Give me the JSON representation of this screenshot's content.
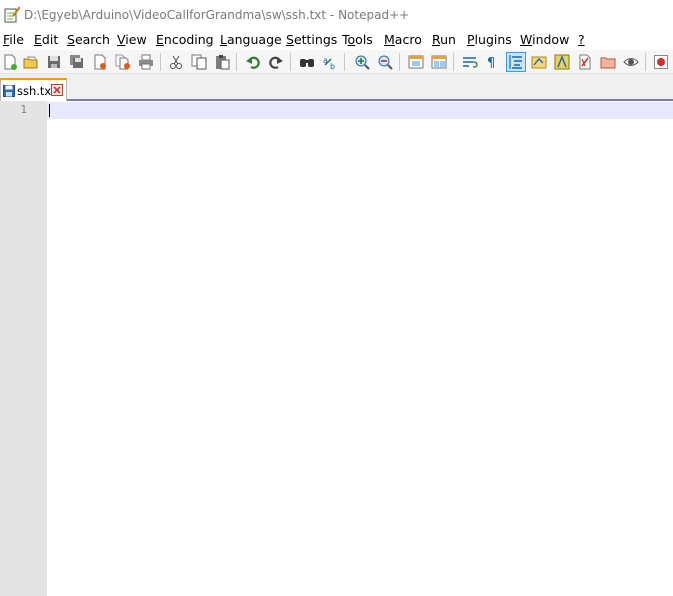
{
  "window": {
    "title": "D:\\Egyeb\\Arduino\\VideoCallforGrandma\\sw\\ssh.txt - Notepad++"
  },
  "menu": [
    {
      "label_u": "F",
      "label_rest": "ile"
    },
    {
      "label_u": "E",
      "label_rest": "dit"
    },
    {
      "label_u": "S",
      "label_rest": "earch"
    },
    {
      "label_u": "V",
      "label_rest": "iew"
    },
    {
      "label_u": "E",
      "label_rest": "ncoding"
    },
    {
      "label_u": "L",
      "label_rest": "anguage"
    },
    {
      "label_u": "S",
      "label_rest": "ettings"
    },
    {
      "label_pre": "T",
      "label_u": "o",
      "label_rest": "ols"
    },
    {
      "label_u": "M",
      "label_rest": "acro"
    },
    {
      "label_u": "R",
      "label_rest": "un"
    },
    {
      "label_u": "P",
      "label_rest": "lugins"
    },
    {
      "label_u": "W",
      "label_rest": "indow"
    },
    {
      "label_u": "?",
      "label_rest": ""
    }
  ],
  "toolbar": {
    "buttons": [
      "new-file-icon",
      "open-file-icon",
      "save-icon",
      "save-all-icon",
      "close-icon",
      "close-all-icon",
      "print-icon",
      "cut-icon",
      "copy-icon",
      "paste-icon",
      "undo-icon",
      "redo-icon",
      "find-icon",
      "replace-icon",
      "zoom-in-icon",
      "zoom-out-icon",
      "sync-vertical-icon",
      "sync-horizontal-icon",
      "word-wrap-icon",
      "show-all-characters-icon",
      "indent-guide-icon",
      "language-icon",
      "function-list-icon",
      "document-map-icon",
      "folder-workspace-icon",
      "monitoring-icon",
      "record-macro-icon"
    ],
    "active": "indent-guide-icon"
  },
  "tabs": [
    {
      "label": "ssh.txt",
      "icon": "saved-file-icon"
    }
  ],
  "editor": {
    "line_numbers": [
      "1"
    ],
    "content": ""
  },
  "colors": {
    "tab_accent": "#fa9b00",
    "gutter": "#e4e4e4",
    "current_line": "#e8e8ff",
    "title_text": "#7a7a7a"
  }
}
